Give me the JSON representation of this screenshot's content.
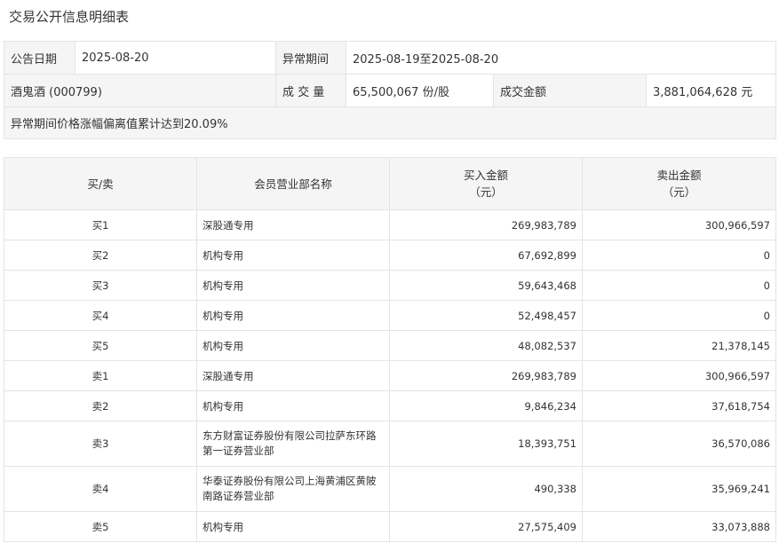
{
  "title": "交易公开信息明细表",
  "info": {
    "announce_date_label": "公告日期",
    "announce_date": "2025-08-20",
    "abnormal_period_label": "异常期间",
    "abnormal_period": "2025-08-19至2025-08-20",
    "stock": "酒鬼酒 (000799)",
    "volume_label": "成 交 量",
    "volume": "65,500,067 份/股",
    "amount_label": "成交金额",
    "amount": "3,881,064,628 元",
    "reason": "异常期间价格涨幅偏离值累计达到20.09%"
  },
  "table": {
    "headers": {
      "side": "买/卖",
      "member": "会员营业部名称",
      "buy_line1": "买入金额",
      "buy_line2": "（元）",
      "sell_line1": "卖出金额",
      "sell_line2": "（元）"
    },
    "rows": [
      {
        "side": "买1",
        "member": "深股通专用",
        "buy": "269,983,789",
        "sell": "300,966,597"
      },
      {
        "side": "买2",
        "member": "机构专用",
        "buy": "67,692,899",
        "sell": "0"
      },
      {
        "side": "买3",
        "member": "机构专用",
        "buy": "59,643,468",
        "sell": "0"
      },
      {
        "side": "买4",
        "member": "机构专用",
        "buy": "52,498,457",
        "sell": "0"
      },
      {
        "side": "买5",
        "member": "机构专用",
        "buy": "48,082,537",
        "sell": "21,378,145"
      },
      {
        "side": "卖1",
        "member": "深股通专用",
        "buy": "269,983,789",
        "sell": "300,966,597"
      },
      {
        "side": "卖2",
        "member": "机构专用",
        "buy": "9,846,234",
        "sell": "37,618,754"
      },
      {
        "side": "卖3",
        "member": "东方财富证券股份有限公司拉萨东环路第一证券营业部",
        "buy": "18,393,751",
        "sell": "36,570,086"
      },
      {
        "side": "卖4",
        "member": "华泰证券股份有限公司上海黄浦区黄陂南路证券营业部",
        "buy": "490,338",
        "sell": "35,969,241"
      },
      {
        "side": "卖5",
        "member": "机构专用",
        "buy": "27,575,409",
        "sell": "33,073,888"
      }
    ]
  }
}
